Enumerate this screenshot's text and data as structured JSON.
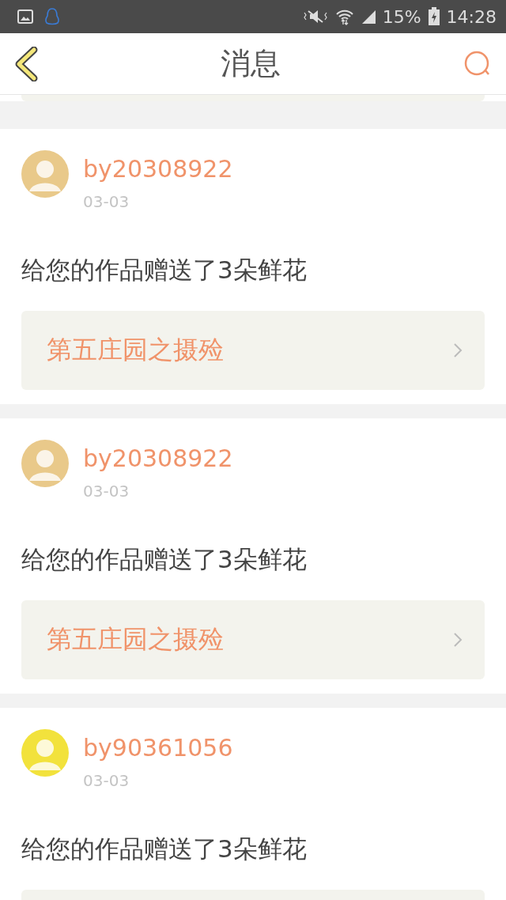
{
  "status_bar": {
    "battery": "15%",
    "time": "14:28"
  },
  "header": {
    "title": "消息"
  },
  "messages": [
    {
      "user": "by20308922",
      "date": "03-03",
      "text": "给您的作品赠送了3朵鲜花",
      "link": "第五庄园之摄殓"
    },
    {
      "user": "by20308922",
      "date": "03-03",
      "text": "给您的作品赠送了3朵鲜花",
      "link": "第五庄园之摄殓"
    },
    {
      "user": "by90361056",
      "date": "03-03",
      "text": "给您的作品赠送了3朵鲜花"
    }
  ]
}
